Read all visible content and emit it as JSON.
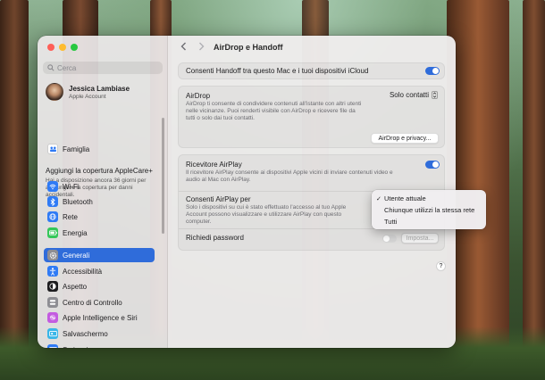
{
  "window": {
    "title": "AirDrop e Handoff"
  },
  "sidebar": {
    "search_placeholder": "Cerca",
    "account": {
      "name": "Jessica Lambiase",
      "subtitle": "Apple Account"
    },
    "family": "Famiglia",
    "applecare": {
      "title": "Aggiungi la copertura AppleCare+",
      "desc": "Hai a disposizione ancora 36 giorni per aggiungere la copertura per danni accidentali."
    },
    "items": [
      {
        "label": "Wi-Fi",
        "icon": "wifi-icon",
        "color": "#2f7bf5"
      },
      {
        "label": "Bluetooth",
        "icon": "bluetooth-icon",
        "color": "#2f7bf5"
      },
      {
        "label": "Rete",
        "icon": "globe-icon",
        "color": "#2f7bf5"
      },
      {
        "label": "Energia",
        "icon": "battery-icon",
        "color": "#34c759"
      },
      {
        "label": "Generali",
        "icon": "gear-icon",
        "color": "#8e8e93"
      },
      {
        "label": "Accessibilità",
        "icon": "accessibility-icon",
        "color": "#2f7bf5"
      },
      {
        "label": "Aspetto",
        "icon": "appearance-icon",
        "color": "#1d1d1f"
      },
      {
        "label": "Centro di Controllo",
        "icon": "control-center-icon",
        "color": "#8e8e93"
      },
      {
        "label": "Apple Intelligence e Siri",
        "icon": "siri-icon",
        "color": "#c35be0"
      },
      {
        "label": "Salvaschermo",
        "icon": "screensaver-icon",
        "color": "#38b6e8"
      },
      {
        "label": "Scrivania",
        "icon": "desktop-icon",
        "color": "#2f7bf5"
      }
    ],
    "selected_index": 4
  },
  "main": {
    "handoff": {
      "label": "Consenti Handoff tra questo Mac e i tuoi dispositivi iCloud",
      "on": true
    },
    "airdrop": {
      "label": "AirDrop",
      "desc": "AirDrop ti consente di condividere contenuti all'istante con altri utenti nelle vicinanze. Puoi renderti visibile con AirDrop e ricevere file da tutti o solo dai tuoi contatti.",
      "value": "Solo contatti",
      "privacy_button": "AirDrop e privacy..."
    },
    "airplay": {
      "label": "Ricevitore AirPlay",
      "desc": "Il ricevitore AirPlay consente ai dispositivi Apple vicini di inviare contenuti video e audio al Mac con AirPlay.",
      "on": true
    },
    "allow_airplay": {
      "label": "Consenti AirPlay per",
      "desc": "Solo i dispositivi su cui è stato effettuato l'accesso al tuo Apple Account possono visualizzare e utilizzare AirPlay con questo computer."
    },
    "password": {
      "label": "Richiedi password",
      "on": false,
      "button": "Imposta..."
    },
    "help": "?"
  },
  "menu": {
    "options": [
      "Utente attuale",
      "Chiunque utilizzi la stessa rete",
      "Tutti"
    ],
    "selected_index": 0,
    "check": "✓"
  }
}
